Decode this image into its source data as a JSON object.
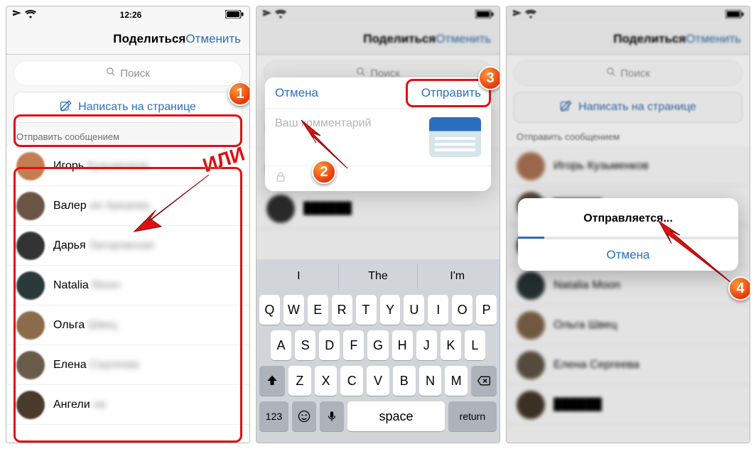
{
  "statusbar": {
    "time": "12:26"
  },
  "navbar": {
    "title": "Поделиться",
    "cancel": "Отменить"
  },
  "search": {
    "placeholder": "Поиск"
  },
  "write_wall": {
    "label": "Написать на странице"
  },
  "section": {
    "send_as_message": "Отправить сообщением"
  },
  "contacts": [
    {
      "first": "Игорь",
      "blurred": "Кузьменков"
    },
    {
      "first": "Валер",
      "blurred": "ия Аркаева"
    },
    {
      "first": "Дарья",
      "blurred": "Загоровская"
    },
    {
      "first": "Natalia",
      "blurred": "Moon"
    },
    {
      "first": "Ольга",
      "blurred": "Швец"
    },
    {
      "first": "Елена",
      "blurred": "Сергеева"
    },
    {
      "first": "Ангели",
      "blurred": "на"
    }
  ],
  "compose": {
    "cancel": "Отмена",
    "send": "Отправить",
    "placeholder": "Ваш комментарий"
  },
  "keyboard": {
    "suggestions": [
      "I",
      "The",
      "I'm"
    ],
    "row1": [
      "Q",
      "W",
      "E",
      "R",
      "T",
      "Y",
      "U",
      "I",
      "O",
      "P"
    ],
    "row2": [
      "A",
      "S",
      "D",
      "F",
      "G",
      "H",
      "J",
      "K",
      "L"
    ],
    "row3": [
      "Z",
      "X",
      "C",
      "V",
      "B",
      "N",
      "M"
    ],
    "fn_123": "123",
    "fn_space": "space",
    "fn_return": "return"
  },
  "alert": {
    "title": "Отправляется...",
    "cancel": "Отмена"
  },
  "annotations": {
    "or": "ИЛИ",
    "step1": "1",
    "step2": "2",
    "step3": "3",
    "step4": "4"
  },
  "colors": {
    "accent": "#2a6fbd",
    "note": "#e53a0d"
  }
}
